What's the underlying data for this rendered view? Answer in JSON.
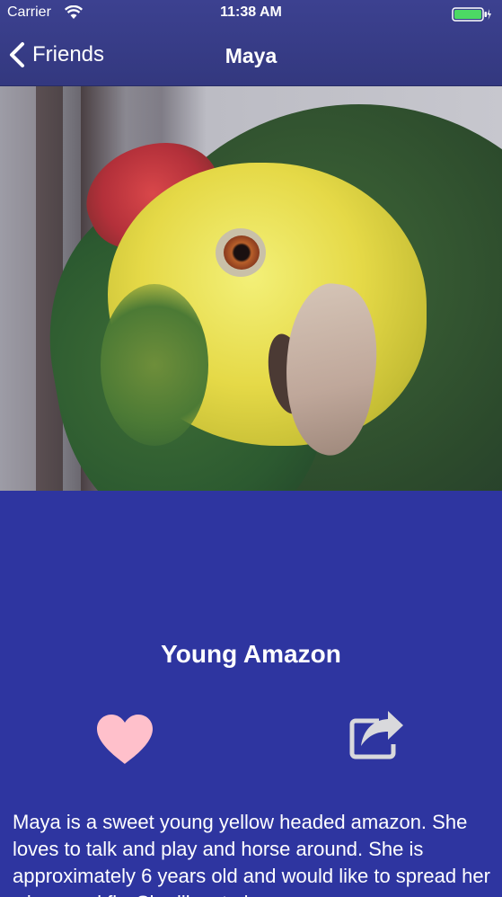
{
  "status_bar": {
    "carrier": "Carrier",
    "time": "11:38 AM",
    "icons": [
      "wifi-icon",
      "battery-icon",
      "charging-bolt-icon"
    ]
  },
  "nav": {
    "back_label": "Friends",
    "title": "Maya"
  },
  "photo": {
    "subject": "parrot-photo"
  },
  "profile": {
    "subtitle": "Young Amazon",
    "description": "Maya is a sweet young yellow headed amazon. She loves to talk and play and horse around. She is approximately 6 years old and would like to spread her wings and fly. She likes to be"
  },
  "actions": {
    "favorite_icon": "heart-icon",
    "share_icon": "share-icon"
  },
  "colors": {
    "background": "#2e35a0",
    "nav_bar": "#383d88",
    "heart": "#ffc0cb",
    "share": "#d9d9dc",
    "text": "#ffffff"
  }
}
